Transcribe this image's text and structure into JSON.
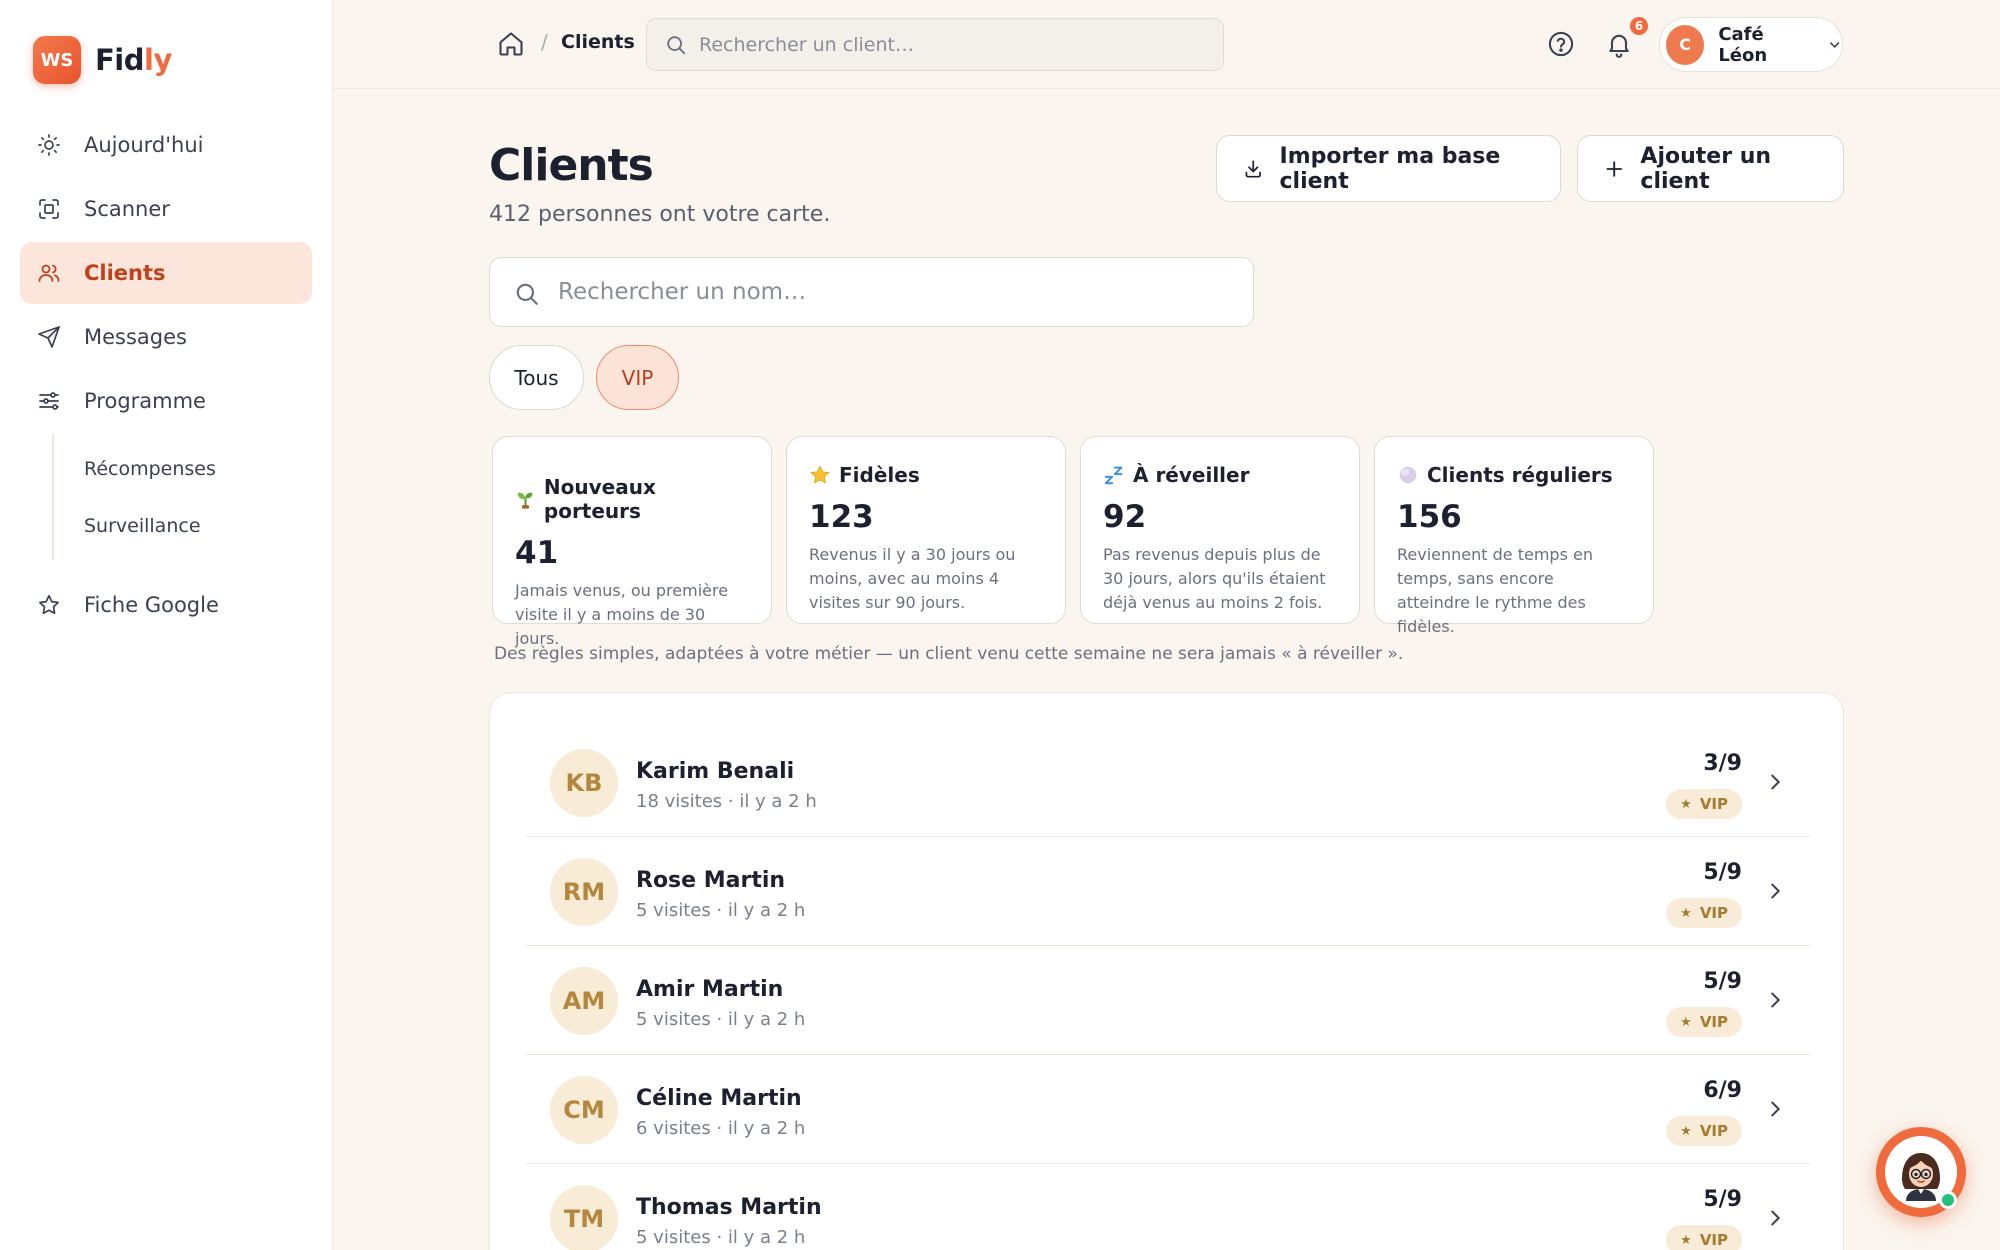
{
  "brand": {
    "badge": "WS",
    "name_main": "Fid",
    "name_accent": "ly"
  },
  "sidebar": {
    "items": [
      {
        "label": "Aujourd'hui",
        "icon": "sun-icon"
      },
      {
        "label": "Scanner",
        "icon": "scan-icon"
      },
      {
        "label": "Clients",
        "icon": "users-icon",
        "active": true
      },
      {
        "label": "Messages",
        "icon": "send-icon"
      },
      {
        "label": "Programme",
        "icon": "sliders-icon"
      }
    ],
    "subitems": [
      {
        "label": "Récompenses"
      },
      {
        "label": "Surveillance"
      }
    ],
    "google": {
      "label": "Fiche Google",
      "icon": "star-icon"
    }
  },
  "topbar": {
    "separator": "/",
    "breadcrumb": "Clients",
    "search_placeholder": "Rechercher un client…",
    "notifications_count": "6",
    "account_initial": "C",
    "account_name": "Café Léon"
  },
  "header": {
    "title": "Clients",
    "subtitle": "412 personnes ont votre carte.",
    "import_label": "Importer ma base client",
    "add_label": "Ajouter un client"
  },
  "search": {
    "placeholder": "Rechercher un nom…"
  },
  "filters": {
    "all": "Tous",
    "vip": "VIP",
    "selected": "VIP"
  },
  "stats": [
    {
      "title": "Nouveaux porteurs",
      "icon": "sprout-icon",
      "value": "41",
      "desc": "Jamais venus, ou première visite il y a moins de 30 jours."
    },
    {
      "title": "Fidèles",
      "icon": "star-icon",
      "value": "123",
      "desc": "Revenus il y a 30 jours ou moins, avec au moins 4 visites sur 90 jours."
    },
    {
      "title": "À réveiller",
      "icon": "sleep-icon",
      "value": "92",
      "desc": "Pas revenus depuis plus de 30 jours, alors qu'ils étaient déjà venus au moins 2 fois."
    },
    {
      "title": "Clients réguliers",
      "icon": "moon-icon",
      "value": "156",
      "desc": "Reviennent de temps en temps, sans encore atteindre le rythme des fidèles."
    }
  ],
  "rules_note": "Des règles simples, adaptées à votre métier — un client venu cette semaine ne sera jamais « à réveiller ».",
  "clients": [
    {
      "initials": "KB",
      "name": "Karim Benali",
      "meta": "18 visites · il y a 2 h",
      "score": "3/9",
      "badge": "VIP"
    },
    {
      "initials": "RM",
      "name": "Rose Martin",
      "meta": "5 visites · il y a 2 h",
      "score": "5/9",
      "badge": "VIP"
    },
    {
      "initials": "AM",
      "name": "Amir Martin",
      "meta": "5 visites · il y a 2 h",
      "score": "5/9",
      "badge": "VIP"
    },
    {
      "initials": "CM",
      "name": "Céline Martin",
      "meta": "6 visites · il y a 2 h",
      "score": "6/9",
      "badge": "VIP"
    },
    {
      "initials": "TM",
      "name": "Thomas Martin",
      "meta": "5 visites · il y a 2 h",
      "score": "5/9",
      "badge": "VIP"
    }
  ],
  "colors": {
    "accent": "#ef6a3c",
    "active_bg": "#fce6dc",
    "background": "#faf5ee",
    "vip_badge": "#f8ecd8"
  }
}
